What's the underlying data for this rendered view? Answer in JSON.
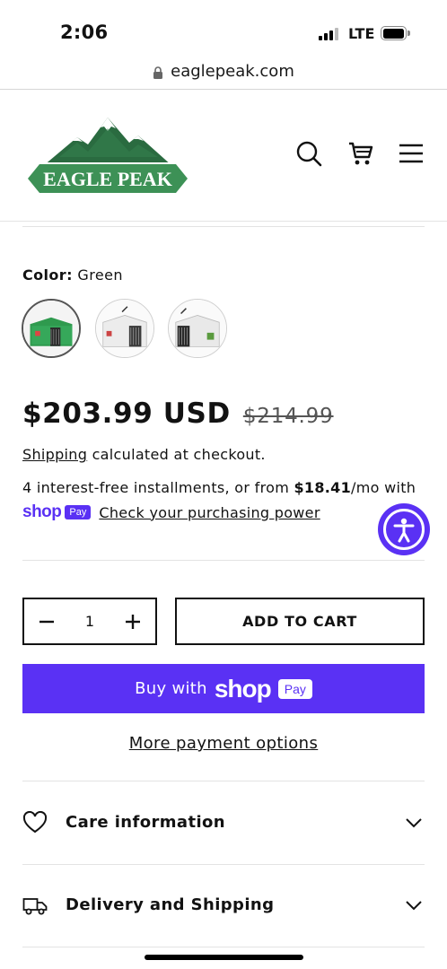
{
  "status_bar": {
    "time": "2:06",
    "network": "LTE"
  },
  "browser": {
    "url": "eaglepeak.com"
  },
  "header": {
    "logo_text": "EAGLE PEAK"
  },
  "product": {
    "color_label": "Color:",
    "color_value": "Green",
    "swatches": [
      "Green",
      "White",
      "White/Black"
    ],
    "price_sale": "$203.99 USD",
    "price_regular": "$214.99",
    "shipping_link": "Shipping",
    "shipping_text": " calculated at checkout.",
    "installments_prefix": "4 interest-free installments, or from ",
    "installments_amount": "$18.41",
    "installments_suffix": "/mo with",
    "shoppay_word": "shop",
    "shoppay_badge": "Pay",
    "check_power": "Check your purchasing power"
  },
  "cart": {
    "quantity": "1",
    "add_to_cart": "ADD TO CART",
    "buy_with": "Buy with",
    "shop_word": "shop",
    "pay_word": "Pay",
    "more_options": "More payment options"
  },
  "accordions": [
    {
      "title": "Care information",
      "icon": "heart-icon"
    },
    {
      "title": "Delivery and Shipping",
      "icon": "truck-icon"
    }
  ],
  "colors": {
    "brand_green": "#2e7d4a",
    "shop_purple": "#5a31f4"
  }
}
